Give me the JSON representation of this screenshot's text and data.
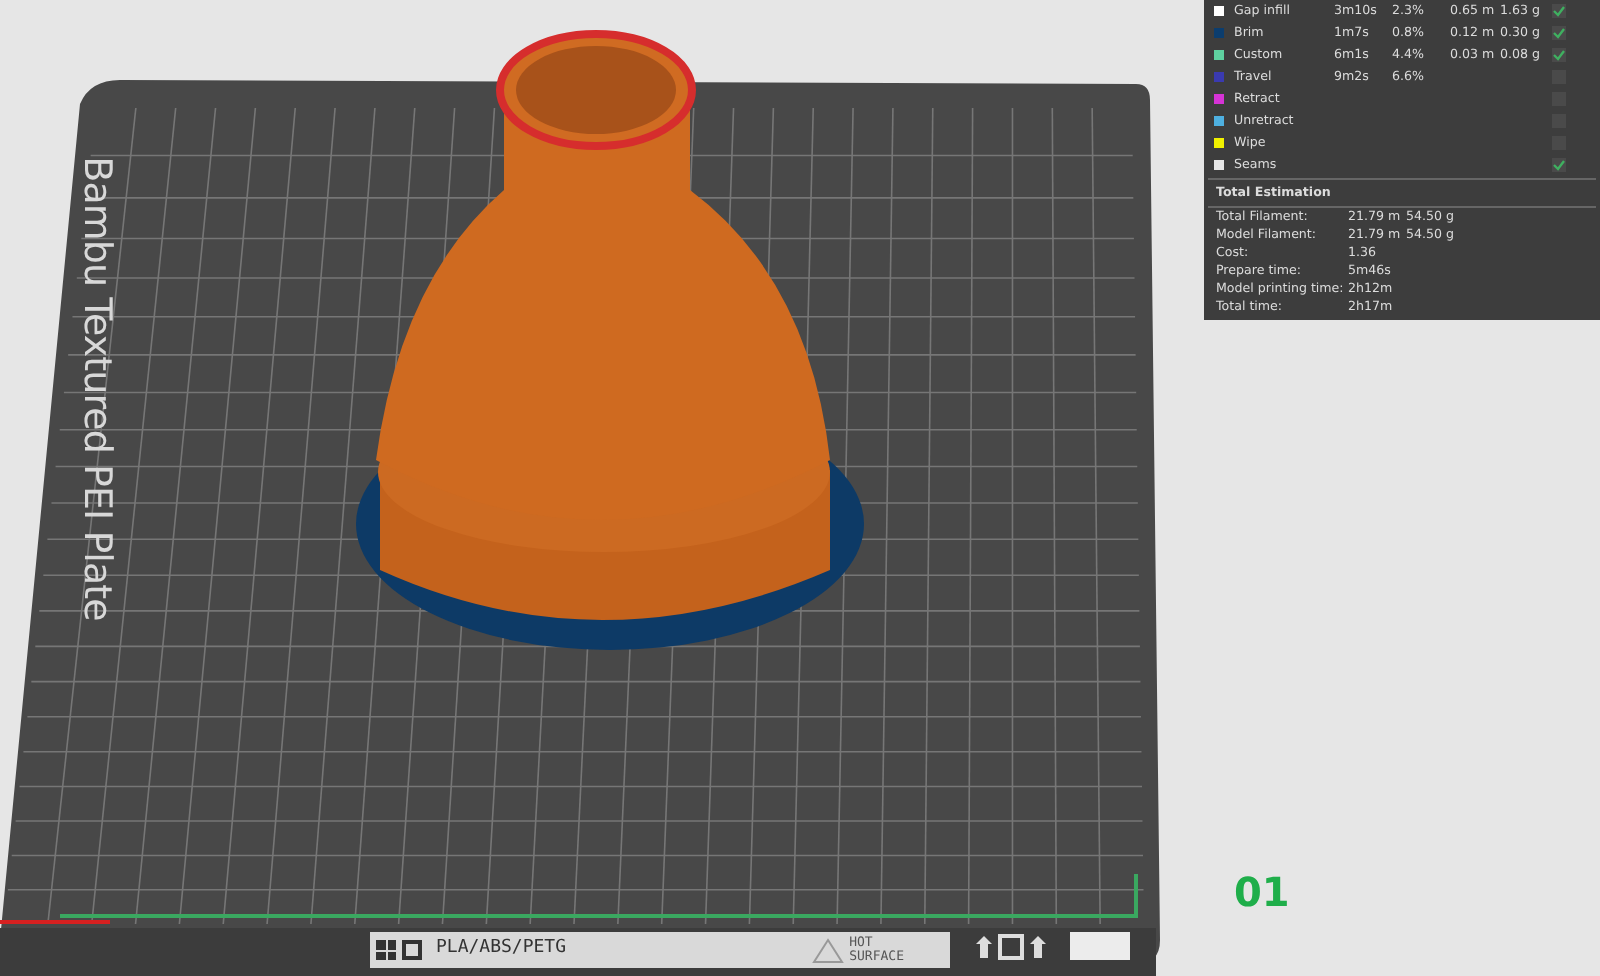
{
  "viewport": {
    "plate_label": "Bambu Textured PEI Plate",
    "plate_number": "01",
    "plate_strip": {
      "material": "PLA/ABS/PETG",
      "warning_lines": [
        "HOT",
        "SURFACE"
      ]
    }
  },
  "legend": {
    "rows": [
      {
        "name": "Gap infill",
        "color": "#ffffff",
        "time": "3m10s",
        "percent": "2.3%",
        "length": "0.65 m",
        "weight": "1.63 g",
        "checked": true
      },
      {
        "name": "Brim",
        "color": "#0b3d6e",
        "time": "1m7s",
        "percent": "0.8%",
        "length": "0.12 m",
        "weight": "0.30 g",
        "checked": true
      },
      {
        "name": "Custom",
        "color": "#5fd1a0",
        "time": "6m1s",
        "percent": "4.4%",
        "length": "0.03 m",
        "weight": "0.08 g",
        "checked": true
      },
      {
        "name": "Travel",
        "color": "#3a3ab0",
        "time": "9m2s",
        "percent": "6.6%",
        "checked": false
      },
      {
        "name": "Retract",
        "color": "#d633d6",
        "checked": false
      },
      {
        "name": "Unretract",
        "color": "#4eb0e0",
        "checked": false
      },
      {
        "name": "Wipe",
        "color": "#f0f000",
        "checked": false
      },
      {
        "name": "Seams",
        "color": "#e6e6e6",
        "checked": true
      }
    ]
  },
  "total_estimation": {
    "title": "Total Estimation",
    "rows": [
      {
        "label": "Total Filament:",
        "values": [
          "21.79 m",
          "54.50 g"
        ]
      },
      {
        "label": "Model Filament:",
        "values": [
          "21.79 m",
          "54.50 g"
        ]
      },
      {
        "label": "Cost:",
        "values": [
          "1.36"
        ]
      },
      {
        "label": "Prepare time:",
        "values": [
          "5m46s"
        ]
      },
      {
        "label": "Model printing time:",
        "values": [
          "2h12m"
        ]
      },
      {
        "label": "Total time:",
        "values": [
          "2h17m"
        ]
      }
    ]
  }
}
